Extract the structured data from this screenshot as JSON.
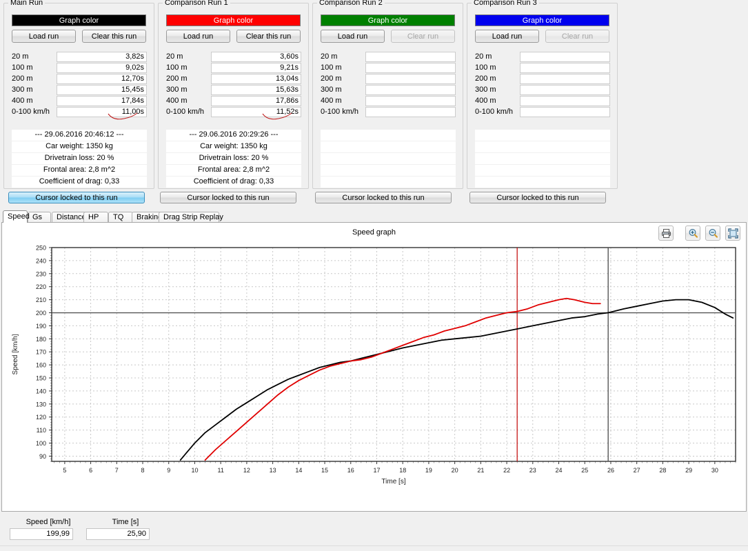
{
  "runs": [
    {
      "legend": "Main Run",
      "color": "#000000",
      "color_label": "Graph color",
      "load_label": "Load run",
      "clear_label": "Clear this run",
      "clear_enabled": true,
      "cursor_label": "Cursor locked to this run",
      "cursor_active": true,
      "has_squiggle": true,
      "metrics": [
        {
          "label": "20 m",
          "value": "3,82s"
        },
        {
          "label": "100 m",
          "value": "9,02s"
        },
        {
          "label": "200 m",
          "value": "12,70s"
        },
        {
          "label": "300 m",
          "value": "15,45s"
        },
        {
          "label": "400 m",
          "value": "17,84s"
        },
        {
          "label": "0-100 km/h",
          "value": "11,00s"
        }
      ],
      "info": [
        "--- 29.06.2016 20:46:12 ---",
        "Car weight: 1350 kg",
        "Drivetrain loss: 20 %",
        "Frontal area: 2,8 m^2",
        "Coefficient of drag: 0,33"
      ]
    },
    {
      "legend": "Comparison Run 1",
      "color": "#FF0000",
      "color_label": "Graph color",
      "load_label": "Load run",
      "clear_label": "Clear this run",
      "clear_enabled": true,
      "cursor_label": "Cursor locked to this run",
      "cursor_active": false,
      "has_squiggle": true,
      "metrics": [
        {
          "label": "20 m",
          "value": "3,60s"
        },
        {
          "label": "100 m",
          "value": "9,21s"
        },
        {
          "label": "200 m",
          "value": "13,04s"
        },
        {
          "label": "300 m",
          "value": "15,63s"
        },
        {
          "label": "400 m",
          "value": "17,86s"
        },
        {
          "label": "0-100 km/h",
          "value": "11,52s"
        }
      ],
      "info": [
        "--- 29.06.2016 20:29:26 ---",
        "Car weight: 1350 kg",
        "Drivetrain loss: 20 %",
        "Frontal area: 2,8 m^2",
        "Coefficient of drag: 0,33"
      ]
    },
    {
      "legend": "Comparison Run 2",
      "color": "#008000",
      "color_label": "Graph color",
      "load_label": "Load run",
      "clear_label": "Clear run",
      "clear_enabled": false,
      "cursor_label": "Cursor locked to this run",
      "cursor_active": false,
      "has_squiggle": false,
      "metrics": [
        {
          "label": "20 m",
          "value": ""
        },
        {
          "label": "100 m",
          "value": ""
        },
        {
          "label": "200 m",
          "value": ""
        },
        {
          "label": "300 m",
          "value": ""
        },
        {
          "label": "400 m",
          "value": ""
        },
        {
          "label": "0-100 km/h",
          "value": ""
        }
      ],
      "info": [
        "",
        "",
        "",
        "",
        ""
      ]
    },
    {
      "legend": "Comparison Run 3",
      "color": "#0000EE",
      "color_label": "Graph color",
      "load_label": "Load run",
      "clear_label": "Clear run",
      "clear_enabled": false,
      "cursor_label": "Cursor locked to this run",
      "cursor_active": false,
      "has_squiggle": false,
      "metrics": [
        {
          "label": "20 m",
          "value": ""
        },
        {
          "label": "100 m",
          "value": ""
        },
        {
          "label": "200 m",
          "value": ""
        },
        {
          "label": "300 m",
          "value": ""
        },
        {
          "label": "400 m",
          "value": ""
        },
        {
          "label": "0-100 km/h",
          "value": ""
        }
      ],
      "info": [
        "",
        "",
        "",
        "",
        ""
      ]
    }
  ],
  "tabs": [
    {
      "label": "Speed",
      "active": true
    },
    {
      "label": "Gs",
      "active": false
    },
    {
      "label": "Distance",
      "active": false
    },
    {
      "label": "HP",
      "active": false
    },
    {
      "label": "TQ",
      "active": false
    },
    {
      "label": "Braking",
      "active": false
    },
    {
      "label": "Drag Strip Replay",
      "active": false
    }
  ],
  "toolbar": {
    "print": "print-icon",
    "zoom_in": "zoom-in-icon",
    "zoom_out": "zoom-out-icon",
    "fit": "fit-to-window-icon"
  },
  "readouts": {
    "speed_label": "Speed [km/h]",
    "speed_value": "199,99",
    "time_label": "Time [s]",
    "time_value": "25,90"
  },
  "chart_data": {
    "type": "line",
    "title": "Speed graph",
    "xlabel": "Time [s]",
    "ylabel": "Speed [km/h]",
    "xlim": [
      4.5,
      30.8
    ],
    "ylim": [
      86,
      250
    ],
    "xticks": [
      5,
      6,
      7,
      8,
      9,
      10,
      11,
      12,
      13,
      14,
      15,
      16,
      17,
      18,
      19,
      20,
      21,
      22,
      23,
      24,
      25,
      26,
      27,
      28,
      29,
      30
    ],
    "yticks": [
      90,
      100,
      110,
      120,
      130,
      140,
      150,
      160,
      170,
      180,
      190,
      200,
      210,
      220,
      230,
      240,
      250
    ],
    "grid": true,
    "legend_position": "none",
    "cursors": [
      {
        "name": "main-cursor",
        "color": "#555555",
        "x": 25.9,
        "y": 199.99,
        "orientation": "crosshair"
      },
      {
        "name": "comparison-cursor",
        "color": "#C00000",
        "x": 22.4,
        "orientation": "vertical"
      }
    ],
    "series": [
      {
        "name": "Main Run",
        "color": "#000000",
        "points": [
          [
            9.45,
            87
          ],
          [
            9.7,
            93
          ],
          [
            10.0,
            100
          ],
          [
            10.4,
            108
          ],
          [
            10.8,
            114
          ],
          [
            11.2,
            120
          ],
          [
            11.6,
            126
          ],
          [
            12.0,
            131
          ],
          [
            12.4,
            136
          ],
          [
            12.8,
            141
          ],
          [
            13.2,
            145
          ],
          [
            13.6,
            149
          ],
          [
            14.0,
            152
          ],
          [
            14.4,
            155
          ],
          [
            14.8,
            158
          ],
          [
            15.2,
            160
          ],
          [
            15.6,
            162
          ],
          [
            16.0,
            163
          ],
          [
            16.4,
            165
          ],
          [
            16.8,
            167
          ],
          [
            17.2,
            169
          ],
          [
            17.6,
            171
          ],
          [
            18.0,
            173
          ],
          [
            18.5,
            175
          ],
          [
            19.0,
            177
          ],
          [
            19.5,
            179
          ],
          [
            20.0,
            180
          ],
          [
            20.5,
            181
          ],
          [
            21.0,
            182
          ],
          [
            21.5,
            184
          ],
          [
            22.0,
            186
          ],
          [
            22.5,
            188
          ],
          [
            23.0,
            190
          ],
          [
            23.5,
            192
          ],
          [
            24.0,
            194
          ],
          [
            24.5,
            196
          ],
          [
            25.0,
            197
          ],
          [
            25.5,
            199
          ],
          [
            25.9,
            200
          ],
          [
            26.5,
            203
          ],
          [
            27.0,
            205
          ],
          [
            27.5,
            207
          ],
          [
            28.0,
            209
          ],
          [
            28.5,
            210
          ],
          [
            29.0,
            210
          ],
          [
            29.5,
            208
          ],
          [
            30.0,
            204
          ],
          [
            30.4,
            199
          ],
          [
            30.7,
            196
          ]
        ]
      },
      {
        "name": "Comparison Run 1",
        "color": "#E00000",
        "points": [
          [
            10.4,
            87
          ],
          [
            10.8,
            95
          ],
          [
            11.2,
            102
          ],
          [
            11.6,
            109
          ],
          [
            12.0,
            116
          ],
          [
            12.4,
            123
          ],
          [
            12.8,
            130
          ],
          [
            13.2,
            137
          ],
          [
            13.6,
            143
          ],
          [
            14.0,
            148
          ],
          [
            14.4,
            152
          ],
          [
            14.8,
            156
          ],
          [
            15.2,
            159
          ],
          [
            15.6,
            161
          ],
          [
            16.0,
            163
          ],
          [
            16.4,
            164
          ],
          [
            16.8,
            166
          ],
          [
            17.2,
            169
          ],
          [
            17.6,
            172
          ],
          [
            18.0,
            175
          ],
          [
            18.4,
            178
          ],
          [
            18.8,
            181
          ],
          [
            19.2,
            183
          ],
          [
            19.6,
            186
          ],
          [
            20.0,
            188
          ],
          [
            20.4,
            190
          ],
          [
            20.8,
            193
          ],
          [
            21.2,
            196
          ],
          [
            21.6,
            198
          ],
          [
            22.0,
            200
          ],
          [
            22.4,
            201
          ],
          [
            22.8,
            203
          ],
          [
            23.2,
            206
          ],
          [
            23.6,
            208
          ],
          [
            24.0,
            210
          ],
          [
            24.3,
            211
          ],
          [
            24.6,
            210
          ],
          [
            25.0,
            208
          ],
          [
            25.3,
            207
          ],
          [
            25.6,
            207
          ]
        ]
      }
    ]
  }
}
